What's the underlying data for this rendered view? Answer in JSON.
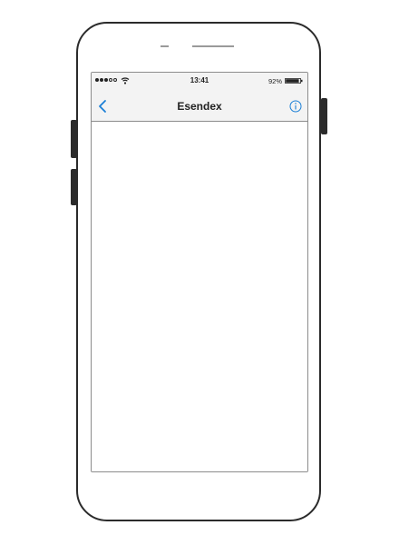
{
  "status_bar": {
    "time": "13:41",
    "battery_percent": "92%",
    "battery_level": 0.92,
    "signal_bars_filled": 3,
    "signal_bars_total": 5
  },
  "nav_bar": {
    "title": "Esendex",
    "back_icon": "chevron-left-icon",
    "info_icon": "info-icon"
  },
  "colors": {
    "accent": "#1a7fd6",
    "bar_background": "#f3f3f3",
    "device_outline": "#2b2b2b"
  }
}
